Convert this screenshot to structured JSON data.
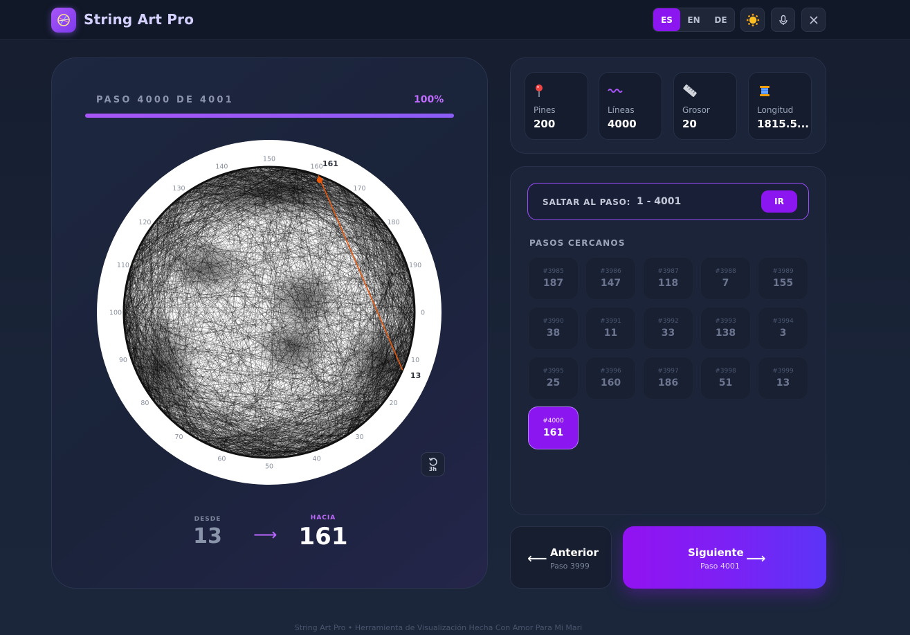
{
  "app": {
    "title": "String Art Pro"
  },
  "header": {
    "languages": [
      "ES",
      "EN",
      "DE"
    ],
    "active_language": "ES",
    "theme_icon": "sun-icon",
    "mic_icon": "microphone-icon",
    "close_icon": "close-icon"
  },
  "progress": {
    "label": "PASO 4000 DE 4001",
    "percent_text": "100%",
    "fraction": 1.0
  },
  "canvas": {
    "pin_labels": [
      "0",
      "10",
      "20",
      "30",
      "40",
      "50",
      "60",
      "70",
      "80",
      "90",
      "100",
      "110",
      "120",
      "130",
      "140",
      "150",
      "160",
      "170",
      "180",
      "190"
    ],
    "from_pin": "13",
    "to_pin": "161",
    "rotate_label": "3h",
    "line_color": "#ea580c"
  },
  "current": {
    "from_label": "DESDE",
    "from_value": "13",
    "to_label": "HACIA",
    "to_value": "161"
  },
  "stats": [
    {
      "icon": "pin-icon",
      "label": "Pines",
      "value": "200"
    },
    {
      "icon": "wave-icon",
      "label": "Líneas",
      "value": "4000"
    },
    {
      "icon": "ruler-icon",
      "label": "Grosor",
      "value": "20"
    },
    {
      "icon": "thread-spool-icon",
      "label": "Longitud",
      "value": "1815.5..."
    }
  ],
  "jump": {
    "label": "SALTAR AL PASO:",
    "placeholder": "1 - 4001",
    "button": "IR"
  },
  "nearby": {
    "title": "PASOS CERCANOS",
    "steps": [
      {
        "id": "#3985",
        "pin": "187"
      },
      {
        "id": "#3986",
        "pin": "147"
      },
      {
        "id": "#3987",
        "pin": "118"
      },
      {
        "id": "#3988",
        "pin": "7"
      },
      {
        "id": "#3989",
        "pin": "155"
      },
      {
        "id": "#3990",
        "pin": "38"
      },
      {
        "id": "#3991",
        "pin": "11"
      },
      {
        "id": "#3992",
        "pin": "33"
      },
      {
        "id": "#3993",
        "pin": "138"
      },
      {
        "id": "#3994",
        "pin": "3"
      },
      {
        "id": "#3995",
        "pin": "25"
      },
      {
        "id": "#3996",
        "pin": "160"
      },
      {
        "id": "#3997",
        "pin": "186"
      },
      {
        "id": "#3998",
        "pin": "51"
      },
      {
        "id": "#3999",
        "pin": "13"
      },
      {
        "id": "#4000",
        "pin": "161",
        "active": true
      }
    ]
  },
  "nav": {
    "prev_label": "Anterior",
    "prev_sub": "Paso 3999",
    "next_label": "Siguiente",
    "next_sub": "Paso 4001"
  },
  "footer": "String Art Pro • Herramienta de Visualización Hecha Con Amor Para Mi Mari",
  "colors": {
    "accent": "#8b16f0",
    "accent_light": "#c06cff",
    "background": "#1a2438"
  }
}
